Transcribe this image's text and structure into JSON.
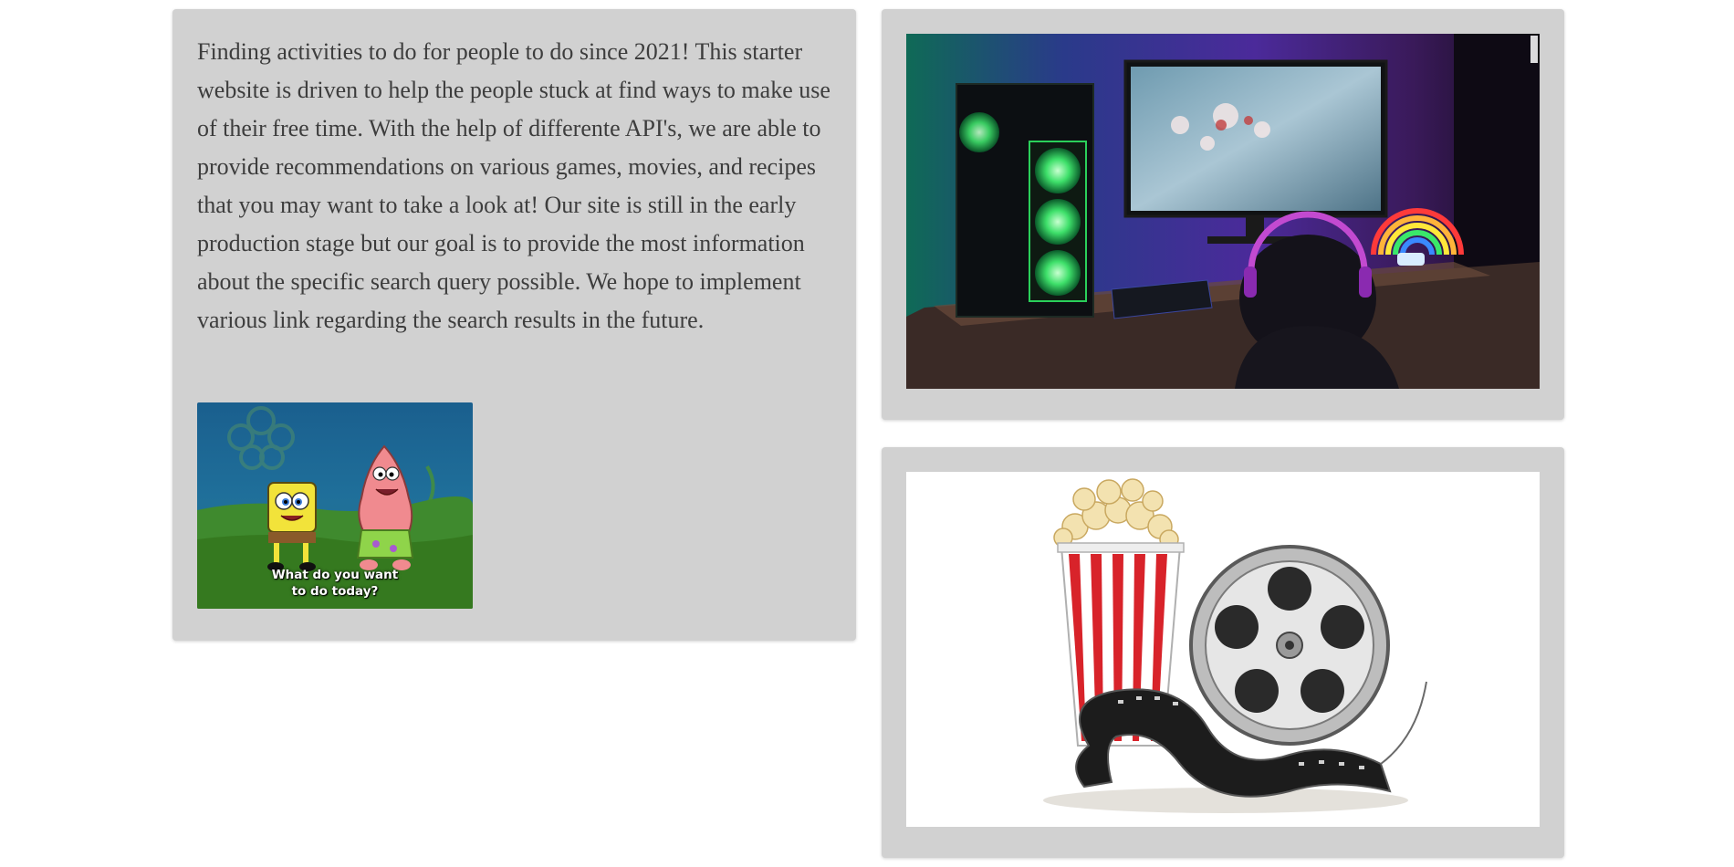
{
  "about": {
    "text": "Finding activities to do for people to do since 2021! This starter website is driven to help the people stuck at find ways to make use of their free time. With the help of differente API's, we are able to provide recommendations on various games, movies, and recipes that you may want to take a look at! Our site is still in the early production stage but our goal is to provide the most information about the specific search query possible. We hope to implement various link regarding the search results in the future.",
    "gif_caption": "What do you want\nto do today?"
  },
  "images": {
    "gaming": "gaming-setup-photo",
    "gif": "spongebob-patrick-gif",
    "movie": "popcorn-film-reel-photo"
  },
  "colors": {
    "card_bg": "#d1d1d1",
    "text": "#3d3d3d",
    "page_bg": "#ffffff"
  }
}
